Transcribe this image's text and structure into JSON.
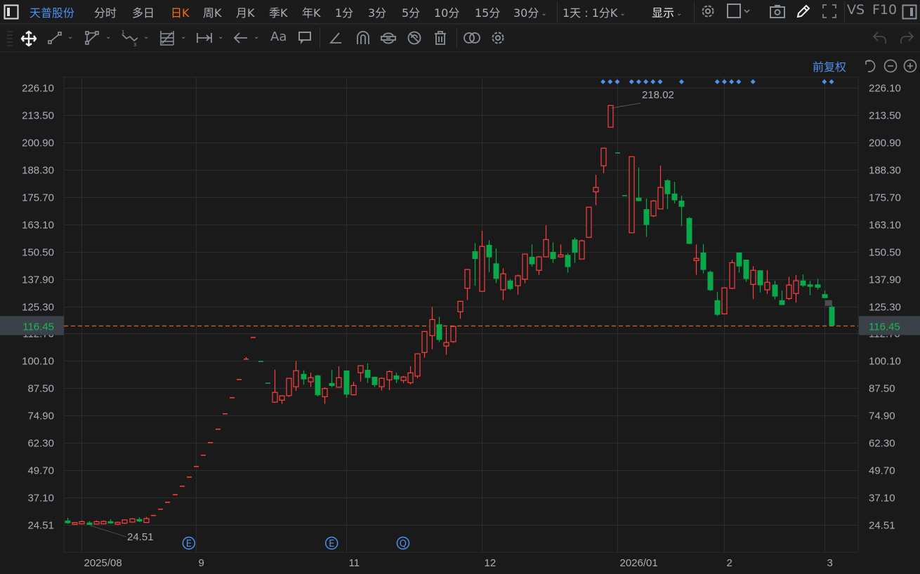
{
  "topbar": {
    "stock_name": "天普股份",
    "tabs": [
      "分时",
      "多日",
      "日K",
      "周K",
      "月K",
      "季K",
      "年K",
      "1分",
      "3分",
      "5分",
      "10分",
      "15分",
      "30分"
    ],
    "active_tab": "日K",
    "range_select": "1天 : 1分K",
    "display_menu": "显示",
    "vs_label": "VS",
    "f10_label": "F10",
    "icons": [
      "layout-panel-icon",
      "gear-icon",
      "square-icon",
      "camera-icon",
      "pencil-icon",
      "fullscreen-icon",
      "right-panel-icon"
    ]
  },
  "toolbar": {
    "tools": [
      "move-icon",
      "line-icon",
      "polygon-icon",
      "wave-icon",
      "fib-grid-icon",
      "measure-icon",
      "arrow-icon",
      "text-icon",
      "comment-icon",
      "angle-icon",
      "magnet-icon",
      "lock-drawing-icon",
      "hide-drawing-icon",
      "trash-icon",
      "compare-icon",
      "settings-icon",
      "undo-icon",
      "redo-icon"
    ],
    "text_tool_label": "Aa"
  },
  "chart_header": {
    "adjust_label": "前复权",
    "icons": [
      "reset-icon",
      "zoom-out-icon",
      "zoom-in-icon"
    ]
  },
  "chart_data": {
    "type": "candlestick",
    "colors": {
      "up": "#ff4040",
      "down": "#0aa84a",
      "last_price_line": "#e0661a",
      "marker": "#4d90ee",
      "grid": "#2c2c2c"
    },
    "y_ticks": [
      "226.10",
      "213.50",
      "200.90",
      "188.30",
      "175.70",
      "163.10",
      "150.50",
      "137.90",
      "125.30",
      "112.70",
      "100.10",
      "87.50",
      "74.90",
      "62.30",
      "49.70",
      "37.10",
      "24.51"
    ],
    "ylim": [
      24.51,
      226.1
    ],
    "grid": true,
    "x_ticks": [
      {
        "label": "2025/08",
        "index": 2
      },
      {
        "label": "9",
        "index": 18
      },
      {
        "label": "11",
        "index": 39
      },
      {
        "label": "12",
        "index": 58
      },
      {
        "label": "2026/01",
        "index": 77
      },
      {
        "label": "2",
        "index": 92
      },
      {
        "label": "3",
        "index": 106
      }
    ],
    "last_price": "116.45",
    "max_label": {
      "value": "218.02",
      "index": 76
    },
    "min_label": {
      "value": "24.51",
      "index": 3
    },
    "events": [
      {
        "label": "E",
        "index": 17
      },
      {
        "label": "E",
        "index": 37
      },
      {
        "label": "Q",
        "index": 47
      }
    ],
    "top_markers": [
      75,
      76,
      77,
      79,
      80,
      81,
      82,
      83,
      86,
      91,
      92,
      93,
      94,
      96,
      106,
      107
    ],
    "ohlc_fields": [
      "open",
      "high",
      "low",
      "close"
    ],
    "ohlc": [
      [
        26.5,
        27.8,
        25.0,
        25.3
      ],
      [
        24.8,
        25.8,
        24.6,
        25.6
      ],
      [
        25.0,
        26.6,
        24.8,
        26.0
      ],
      [
        25.6,
        26.2,
        24.51,
        24.51
      ],
      [
        24.9,
        26.5,
        24.7,
        26.0
      ],
      [
        25.0,
        26.6,
        24.8,
        26.1
      ],
      [
        26.2,
        27.1,
        25.0,
        25.2
      ],
      [
        24.8,
        25.9,
        24.6,
        25.7
      ],
      [
        25.3,
        27.0,
        25.0,
        26.8
      ],
      [
        25.8,
        27.6,
        25.6,
        27.3
      ],
      [
        27.2,
        28.0,
        25.9,
        26.1
      ],
      [
        25.6,
        28.2,
        25.4,
        27.4
      ],
      [
        29.0,
        29.0,
        29.0,
        29.0
      ],
      [
        31.9,
        31.9,
        31.9,
        31.9
      ],
      [
        35.1,
        35.1,
        35.1,
        35.1
      ],
      [
        38.6,
        38.6,
        38.6,
        38.6
      ],
      [
        42.5,
        42.5,
        42.5,
        42.5
      ],
      [
        46.7,
        46.7,
        46.7,
        46.7
      ],
      [
        51.6,
        51.6,
        51.6,
        51.6
      ],
      [
        56.8,
        56.8,
        56.8,
        56.8
      ],
      [
        62.6,
        62.6,
        62.6,
        62.6
      ],
      [
        68.8,
        68.8,
        68.8,
        68.8
      ],
      [
        75.9,
        75.9,
        75.9,
        75.9
      ],
      [
        83.3,
        83.3,
        83.3,
        83.3
      ],
      [
        91.7,
        91.7,
        91.7,
        91.7
      ],
      [
        101.1,
        101.9,
        101.1,
        101.1
      ],
      [
        111.1,
        111.1,
        111.1,
        111.1
      ],
      [
        100.0,
        100.0,
        100.0,
        100.0
      ],
      [
        90.0,
        90.0,
        90.0,
        90.0
      ],
      [
        81.1,
        96.1,
        80.8,
        85.6
      ],
      [
        82.0,
        84.3,
        80.3,
        84.0
      ],
      [
        84.1,
        92.3,
        83.5,
        92.1
      ],
      [
        88.2,
        100.1,
        86.3,
        95.6
      ],
      [
        94.1,
        95.8,
        89.2,
        91.6
      ],
      [
        90.5,
        94.7,
        88.1,
        92.4
      ],
      [
        93.4,
        93.8,
        83.8,
        84.3
      ],
      [
        83.6,
        88.0,
        80.3,
        87.4
      ],
      [
        89.9,
        96.0,
        88.0,
        88.6
      ],
      [
        88.0,
        97.6,
        88.0,
        92.4
      ],
      [
        95.7,
        95.7,
        83.1,
        84.6
      ],
      [
        84.5,
        90.5,
        84.5,
        88.8
      ],
      [
        94.7,
        97.9,
        90.6,
        97.9
      ],
      [
        96.0,
        99.0,
        90.0,
        92.3
      ],
      [
        92.8,
        92.8,
        88.1,
        89.0
      ],
      [
        88.2,
        92.5,
        86.5,
        92.1
      ],
      [
        91.4,
        95.8,
        86.7,
        95.2
      ],
      [
        93.4,
        94.7,
        89.9,
        91.6
      ],
      [
        91.1,
        93.2,
        89.9,
        92.7
      ],
      [
        90.1,
        97.6,
        89.3,
        94.6
      ],
      [
        93.1,
        103.4,
        92.1,
        103.4
      ],
      [
        104.0,
        113.9,
        101.6,
        113.7
      ],
      [
        111.8,
        125.0,
        105.5,
        119.2
      ],
      [
        117.0,
        120.5,
        108.8,
        109.8
      ],
      [
        107.0,
        115.7,
        103.0,
        108.6
      ],
      [
        109.0,
        116.0,
        108.5,
        116.0
      ],
      [
        122.8,
        127.8,
        119.6,
        127.6
      ],
      [
        133.6,
        142.5,
        128.2,
        142.3
      ],
      [
        150.7,
        154.5,
        134.8,
        147.1
      ],
      [
        132.2,
        160.1,
        132.0,
        152.9
      ],
      [
        153.6,
        155.8,
        141.1,
        147.9
      ],
      [
        145.1,
        152.0,
        136.0,
        138.0
      ],
      [
        132.9,
        142.8,
        128.2,
        140.3
      ],
      [
        137.2,
        137.9,
        132.7,
        133.3
      ],
      [
        134.8,
        139.9,
        130.7,
        139.4
      ],
      [
        137.8,
        149.6,
        136.0,
        149.4
      ],
      [
        148.1,
        153.8,
        143.6,
        144.7
      ],
      [
        141.9,
        148.5,
        139.8,
        148.1
      ],
      [
        148.1,
        162.6,
        148.1,
        156.1
      ],
      [
        150.4,
        154.8,
        145.3,
        147.1
      ],
      [
        148.1,
        153.8,
        147.8,
        149.0
      ],
      [
        149.0,
        149.8,
        140.8,
        143.4
      ],
      [
        156.1,
        157.0,
        145.3,
        150.0
      ],
      [
        147.1,
        156.0,
        147.1,
        155.5
      ],
      [
        157.1,
        171.0,
        156.8,
        171.0
      ],
      [
        178.1,
        185.9,
        171.9,
        180.1
      ],
      [
        190.1,
        198.5,
        186.7,
        198.2
      ],
      [
        207.9,
        218.02,
        207.9,
        217.9
      ],
      [
        196.2,
        196.2,
        196.2,
        196.2
      ],
      [
        176.5,
        176.5,
        176.5,
        176.5
      ],
      [
        159.2,
        194.3,
        159.2,
        194.3
      ],
      [
        175.4,
        189.3,
        173.8,
        173.8
      ],
      [
        170.1,
        175.0,
        157.3,
        162.8
      ],
      [
        167.0,
        174.3,
        166.5,
        173.9
      ],
      [
        170.2,
        190.2,
        170.2,
        180.1
      ],
      [
        183.4,
        184.0,
        170.1,
        177.0
      ],
      [
        177.3,
        182.7,
        172.7,
        174.2
      ],
      [
        174.0,
        176.3,
        162.4,
        171.2
      ],
      [
        166.0,
        166.5,
        154.0,
        154.1
      ],
      [
        146.4,
        153.8,
        139.8,
        147.4
      ],
      [
        150.1,
        154.0,
        140.5,
        142.1
      ],
      [
        141.2,
        141.8,
        132.4,
        132.7
      ],
      [
        128.1,
        131.9,
        120.8,
        121.4
      ],
      [
        121.8,
        133.8,
        121.8,
        133.8
      ],
      [
        133.6,
        146.7,
        133.3,
        145.4
      ],
      [
        150.1,
        150.1,
        140.8,
        143.7
      ],
      [
        146.8,
        146.8,
        136.6,
        137.9
      ],
      [
        135.4,
        143.8,
        128.6,
        141.9
      ],
      [
        141.9,
        141.9,
        131.7,
        135.0
      ],
      [
        132.9,
        141.9,
        131.0,
        136.4
      ],
      [
        135.3,
        137.0,
        128.6,
        129.8
      ],
      [
        128.1,
        132.6,
        125.9,
        125.9
      ],
      [
        128.9,
        138.9,
        128.2,
        135.1
      ],
      [
        131.2,
        139.8,
        127.0,
        137.1
      ],
      [
        137.2,
        140.0,
        134.3,
        134.8
      ],
      [
        135.4,
        137.0,
        130.4,
        134.3
      ],
      [
        135.4,
        138.0,
        133.0,
        133.9
      ],
      [
        130.9,
        132.6,
        129.1,
        129.1
      ],
      [
        125.1,
        126.0,
        116.45,
        116.45
      ]
    ]
  }
}
